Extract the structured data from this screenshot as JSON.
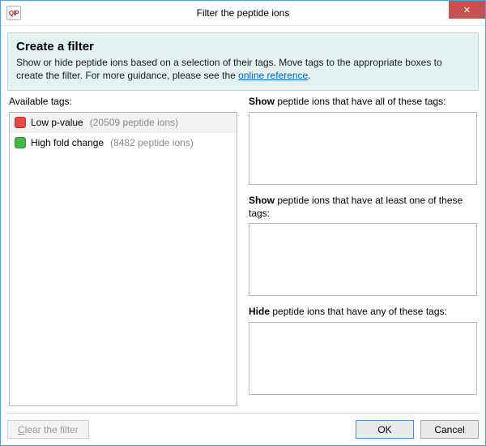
{
  "titlebar": {
    "app_icon_text": "QIP",
    "title": "Filter the peptide ions",
    "close_glyph": "✕"
  },
  "header": {
    "title": "Create a filter",
    "desc_before_link": "Show or hide peptide ions based on a selection of their tags. Move tags to the appropriate boxes to create the filter. For more guidance, please see the ",
    "link_text": "online reference",
    "desc_after_link": "."
  },
  "left": {
    "heading": "Available tags:",
    "tags": [
      {
        "name": "Low p-value",
        "count_label": "(20509 peptide ions)",
        "color": "#e54b4b",
        "selected": true
      },
      {
        "name": "High fold change",
        "count_label": "(8482 peptide ions)",
        "color": "#45b84a",
        "selected": false
      }
    ]
  },
  "right": {
    "box1_prefix": "Show",
    "box1_rest": " peptide ions that have all of these tags:",
    "box2_prefix": "Show",
    "box2_rest": " peptide ions that have at least one of these tags:",
    "box3_prefix": "Hide",
    "box3_rest": " peptide ions that have any of these tags:"
  },
  "footer": {
    "clear_accessor": "C",
    "clear_rest": "lear the filter",
    "ok": "OK",
    "cancel": "Cancel"
  }
}
